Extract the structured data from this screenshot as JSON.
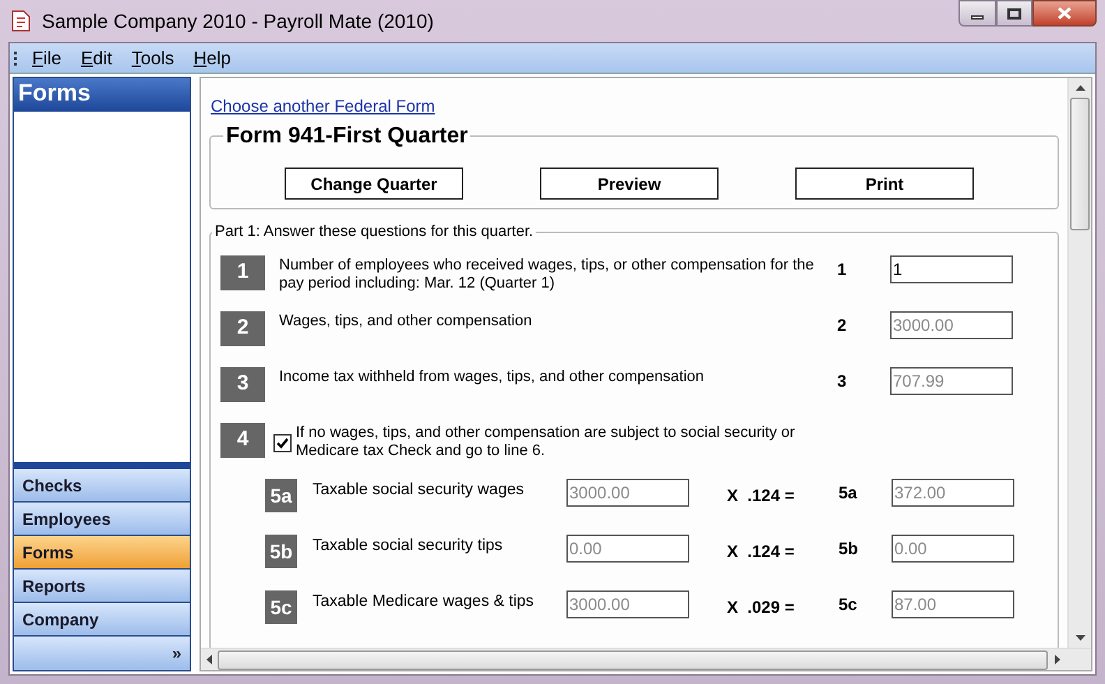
{
  "window": {
    "title": "Sample Company 2010 - Payroll Mate (2010)"
  },
  "menu": [
    "File",
    "Edit",
    "Tools",
    "Help"
  ],
  "sidebar": {
    "header": "Forms",
    "items": [
      {
        "label": "Checks",
        "selected": false
      },
      {
        "label": "Employees",
        "selected": false
      },
      {
        "label": "Forms",
        "selected": true
      },
      {
        "label": "Reports",
        "selected": false
      },
      {
        "label": "Company",
        "selected": false
      }
    ],
    "more": "»"
  },
  "link": "Choose another Federal Form",
  "form": {
    "title": "Form 941-First Quarter",
    "buttons": [
      "Change Quarter",
      "Preview",
      "Print"
    ]
  },
  "part": {
    "legend": "Part 1: Answer these questions for this quarter.",
    "lines": [
      {
        "kind": "field",
        "badge": "1",
        "text": "Number of employees who received wages, tips, or other compensation for the pay period including: Mar. 12 (Quarter 1)",
        "line": "1",
        "value": "1",
        "disabled": false
      },
      {
        "kind": "field",
        "badge": "2",
        "text": "Wages, tips, and other compensation",
        "line": "2",
        "value": "3000.00",
        "disabled": true
      },
      {
        "kind": "field",
        "badge": "3",
        "text": "Income tax withheld from wages, tips, and other compensation",
        "line": "3",
        "value": "707.99",
        "disabled": true
      },
      {
        "kind": "check",
        "badge": "4",
        "text": "If no wages, tips, and other compensation are subject to social security or Medicare tax Check and go to line 6.",
        "checked": true
      }
    ],
    "calc": [
      {
        "badge": "5a",
        "text": "Taxable social security wages",
        "input": "3000.00",
        "factor": "X  .124 =",
        "line": "5a",
        "value": "372.00",
        "disabled": true
      },
      {
        "badge": "5b",
        "text": "Taxable social security tips",
        "input": "0.00",
        "factor": "X  .124 =",
        "line": "5b",
        "value": "0.00",
        "disabled": true
      },
      {
        "badge": "5c",
        "text": "Taxable Medicare wages & tips",
        "input": "3000.00",
        "factor": "X  .029 =",
        "line": "5c",
        "value": "87.00",
        "disabled": true
      }
    ]
  }
}
